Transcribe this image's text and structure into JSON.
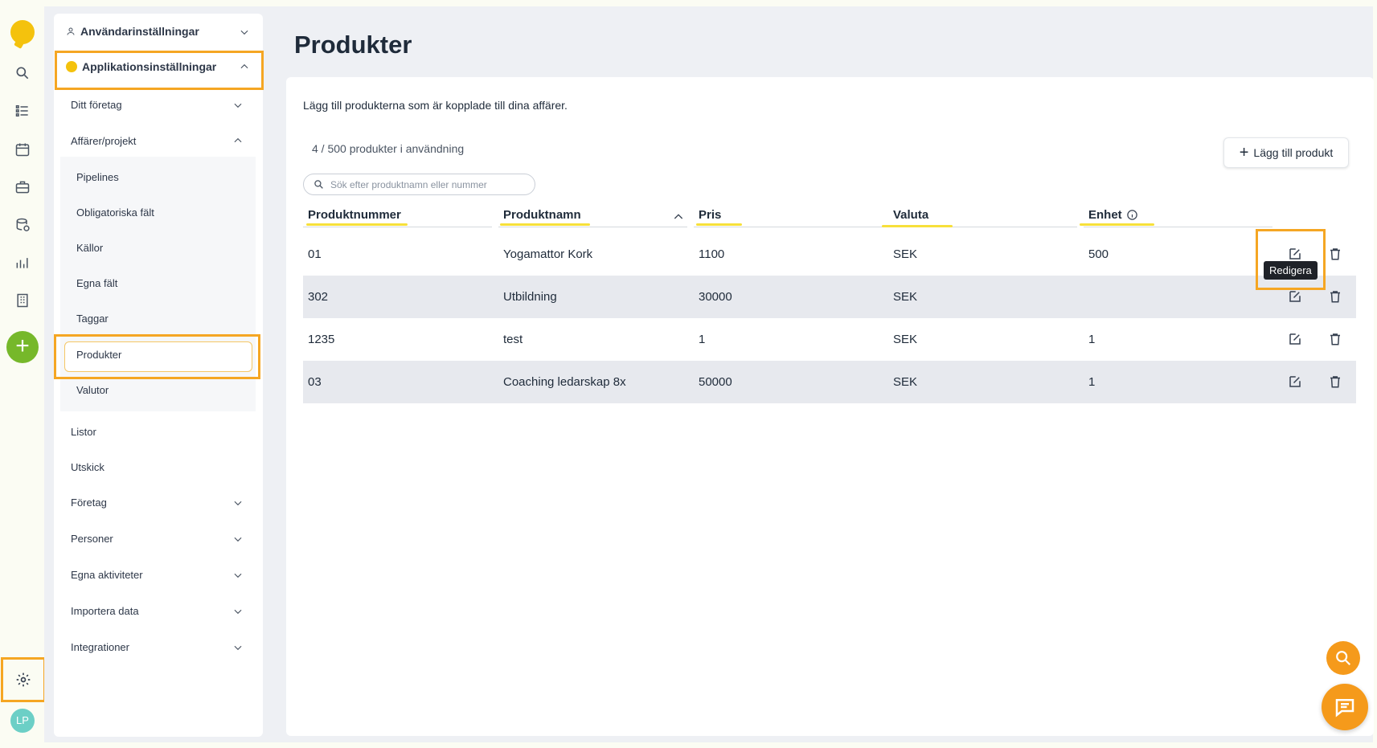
{
  "nav": {
    "avatar_initials": "LP",
    "icons": [
      "logo-icon",
      "search-icon",
      "list-icon",
      "calendar-icon",
      "briefcase-icon",
      "database-icon",
      "chart-icon",
      "building-icon",
      "plus-icon",
      "gear-icon"
    ]
  },
  "sidebar": {
    "user_settings": "Användarinställningar",
    "app_settings": "Applikationsinställningar",
    "items": [
      {
        "label": "Ditt företag"
      },
      {
        "label": "Affärer/projekt"
      }
    ],
    "sub_items": [
      {
        "label": "Pipelines"
      },
      {
        "label": "Obligatoriska fält"
      },
      {
        "label": "Källor"
      },
      {
        "label": "Egna fält"
      },
      {
        "label": "Taggar"
      },
      {
        "label": "Produkter"
      },
      {
        "label": "Valutor"
      }
    ],
    "lower_items": [
      {
        "label": "Listor"
      },
      {
        "label": "Utskick"
      },
      {
        "label": "Företag"
      },
      {
        "label": "Personer"
      },
      {
        "label": "Egna aktiviteter"
      },
      {
        "label": "Importera data"
      },
      {
        "label": "Integrationer"
      }
    ]
  },
  "page": {
    "title": "Produkter",
    "description": "Lägg till produkterna som är kopplade till dina affärer.",
    "count": "4 / 500 produkter i användning",
    "add_button": "Lägg till produkt",
    "search_placeholder": "Sök efter produktnamn eller nummer",
    "tooltip": "Redigera"
  },
  "table": {
    "headers": [
      "Produktnummer",
      "Produktnamn",
      "Pris",
      "Valuta",
      "Enhet"
    ],
    "rows": [
      [
        "01",
        "Yogamattor Kork",
        "1100",
        "SEK",
        "500"
      ],
      [
        "302",
        "Utbildning",
        "30000",
        "SEK",
        ""
      ],
      [
        "1235",
        "test",
        "1",
        "SEK",
        "1"
      ],
      [
        "03",
        "Coaching ledarskap 8x",
        "50000",
        "SEK",
        "1"
      ]
    ]
  },
  "colors": {
    "accent_highlight": "#f5a623",
    "underline": "#f7e03a",
    "add_button": "#76b82a",
    "fab": "#f59a1b"
  }
}
